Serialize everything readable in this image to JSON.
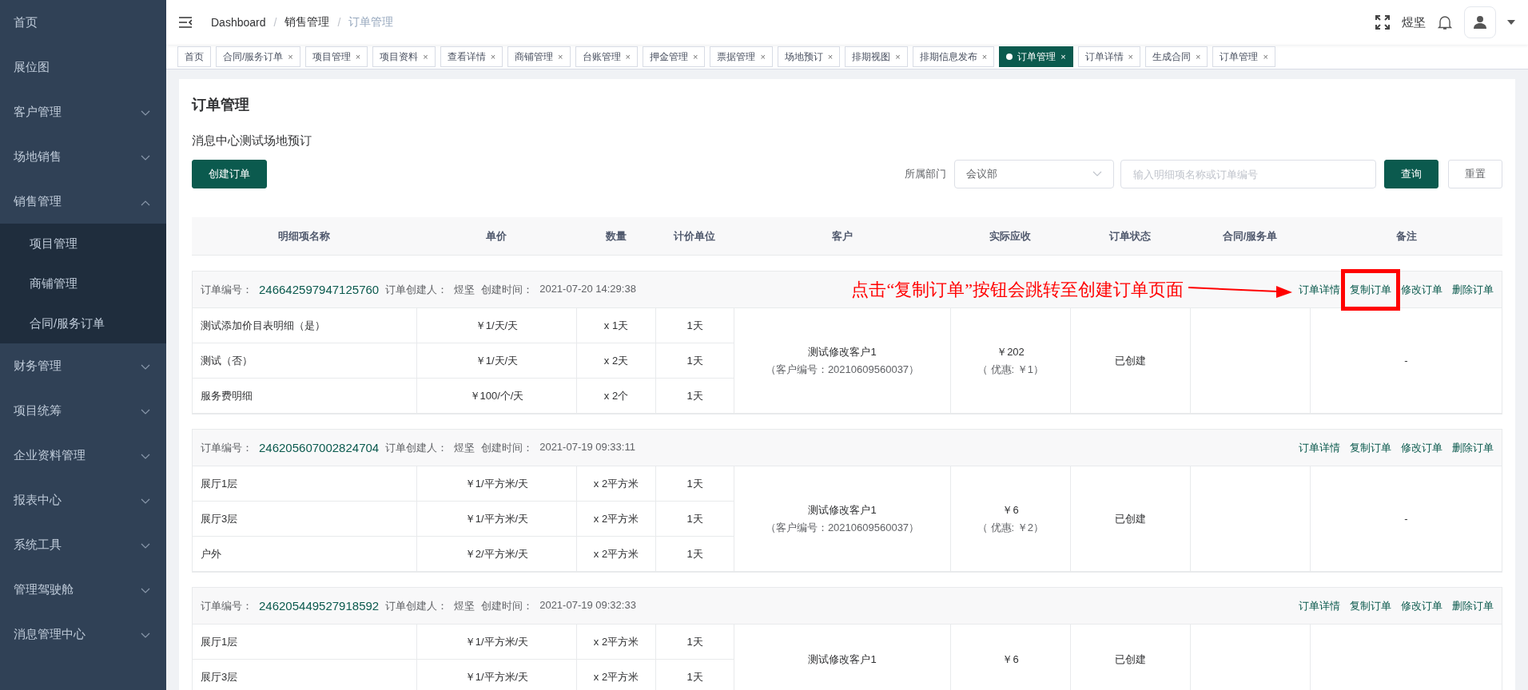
{
  "sidebar": {
    "items": [
      {
        "label": "首页",
        "kind": "link"
      },
      {
        "label": "展位图",
        "kind": "link"
      },
      {
        "label": "客户管理",
        "kind": "submenu",
        "expanded": false
      },
      {
        "label": "场地销售",
        "kind": "submenu",
        "expanded": false
      },
      {
        "label": "销售管理",
        "kind": "submenu",
        "expanded": true,
        "children": [
          {
            "label": "项目管理"
          },
          {
            "label": "商铺管理"
          },
          {
            "label": "合同/服务订单"
          }
        ]
      },
      {
        "label": "财务管理",
        "kind": "submenu",
        "expanded": false
      },
      {
        "label": "项目统筹",
        "kind": "submenu",
        "expanded": false
      },
      {
        "label": "企业资料管理",
        "kind": "submenu",
        "expanded": false
      },
      {
        "label": "报表中心",
        "kind": "submenu",
        "expanded": false
      },
      {
        "label": "系统工具",
        "kind": "submenu",
        "expanded": false
      },
      {
        "label": "管理驾驶舱",
        "kind": "submenu",
        "expanded": false
      },
      {
        "label": "消息管理中心",
        "kind": "submenu",
        "expanded": false
      }
    ]
  },
  "breadcrumb": [
    {
      "label": "Dashboard"
    },
    {
      "separator": "/",
      "label": "销售管理"
    },
    {
      "separator": "/",
      "label": "订单管理"
    }
  ],
  "user": {
    "name": "煜坚"
  },
  "tabs": [
    {
      "label": "首页",
      "selected": false,
      "closable": false
    },
    {
      "label": "合同/服务订单",
      "selected": false,
      "closable": true,
      "close": "×"
    },
    {
      "label": "项目管理",
      "selected": false,
      "closable": true,
      "close": "×"
    },
    {
      "label": "项目资料",
      "selected": false,
      "closable": true,
      "close": "×"
    },
    {
      "label": "查看详情",
      "selected": false,
      "closable": true,
      "close": "×"
    },
    {
      "label": "商铺管理",
      "selected": false,
      "closable": true,
      "close": "×"
    },
    {
      "label": "台账管理",
      "selected": false,
      "closable": true,
      "close": "×"
    },
    {
      "label": "押金管理",
      "selected": false,
      "closable": true,
      "close": "×"
    },
    {
      "label": "票据管理",
      "selected": false,
      "closable": true,
      "close": "×"
    },
    {
      "label": "场地预订",
      "selected": false,
      "closable": true,
      "close": "×"
    },
    {
      "label": "排期视图",
      "selected": false,
      "closable": true,
      "close": "×"
    },
    {
      "label": "排期信息发布",
      "selected": false,
      "closable": true,
      "close": "×"
    },
    {
      "label": "订单管理",
      "selected": true,
      "closable": true,
      "close": "×"
    },
    {
      "label": "订单详情",
      "selected": false,
      "closable": true,
      "close": "×"
    },
    {
      "label": "生成合同",
      "selected": false,
      "closable": true,
      "close": "×"
    },
    {
      "label": "订单管理",
      "selected": false,
      "closable": true,
      "close": "×"
    }
  ],
  "page": {
    "title": "订单管理",
    "subtitle": "消息中心测试场地预订",
    "create_button": "创建订单",
    "filter": {
      "label": "所属部门",
      "department": "会议部",
      "placeholder": "输入明细项名称或订单编号",
      "query_button": "查询",
      "reset_button": "重置"
    }
  },
  "table": {
    "columns": [
      "明细项名称",
      "单价",
      "数量",
      "计价单位",
      "客户",
      "实际应收",
      "订单状态",
      "合同/服务单",
      "备注"
    ]
  },
  "orders": [
    {
      "meta": [
        {
          "label": "订单编号：",
          "value": "246642597947125760",
          "kind": "link"
        },
        {
          "label": "订单创建人：",
          "value": "煜坚",
          "kind": "text"
        },
        {
          "label": "创建时间：",
          "value": "2021-07-20 14:29:38",
          "kind": "text"
        }
      ],
      "annotation": {
        "text": "点击“复制订单”按钮会跳转至创建订单页面"
      },
      "actions": [
        {
          "label": "订单详情",
          "highlighted": false
        },
        {
          "label": "复制订单",
          "highlighted": true
        },
        {
          "label": "修改订单",
          "highlighted": false
        },
        {
          "label": "删除订单",
          "highlighted": false
        }
      ],
      "items": [
        {
          "name": "测试添加价目表明细（是）",
          "price": "￥1/天/天",
          "qty": "x 1天",
          "unit": "1天"
        },
        {
          "name": "测试（否）",
          "price": "￥1/天/天",
          "qty": "x 2天",
          "unit": "1天"
        },
        {
          "name": "服务费明细",
          "price": "￥100/个/天",
          "qty": "x 2个",
          "unit": "1天"
        }
      ],
      "customer": {
        "name": "测试修改客户1",
        "code": "（客户编号：20210609560037）"
      },
      "amount": "￥202",
      "discount": "（ 优惠: ￥1）",
      "status": "已创建",
      "remark": "-"
    },
    {
      "meta": [
        {
          "label": "订单编号：",
          "value": "246205607002824704",
          "kind": "link"
        },
        {
          "label": "订单创建人：",
          "value": "煜坚",
          "kind": "text"
        },
        {
          "label": "创建时间：",
          "value": "2021-07-19 09:33:11",
          "kind": "text"
        }
      ],
      "actions": [
        {
          "label": "订单详情",
          "highlighted": false
        },
        {
          "label": "复制订单",
          "highlighted": false
        },
        {
          "label": "修改订单",
          "highlighted": false
        },
        {
          "label": "删除订单",
          "highlighted": false
        }
      ],
      "items": [
        {
          "name": "展厅1层",
          "price": "￥1/平方米/天",
          "qty": "x 2平方米",
          "unit": "1天"
        },
        {
          "name": "展厅3层",
          "price": "￥1/平方米/天",
          "qty": "x 2平方米",
          "unit": "1天"
        },
        {
          "name": "户外",
          "price": "￥2/平方米/天",
          "qty": "x 2平方米",
          "unit": "1天"
        }
      ],
      "customer": {
        "name": "测试修改客户1",
        "code": "（客户编号：20210609560037）"
      },
      "amount": "￥6",
      "discount": "（ 优惠: ￥2）",
      "status": "已创建",
      "remark": "-"
    },
    {
      "meta": [
        {
          "label": "订单编号：",
          "value": "246205449527918592",
          "kind": "link"
        },
        {
          "label": "订单创建人：",
          "value": "煜坚",
          "kind": "text"
        },
        {
          "label": "创建时间：",
          "value": "2021-07-19 09:32:33",
          "kind": "text"
        }
      ],
      "actions": [
        {
          "label": "订单详情",
          "highlighted": false
        },
        {
          "label": "复制订单",
          "highlighted": false
        },
        {
          "label": "修改订单",
          "highlighted": false
        },
        {
          "label": "删除订单",
          "highlighted": false
        }
      ],
      "items": [
        {
          "name": "展厅1层",
          "price": "￥1/平方米/天",
          "qty": "x 2平方米",
          "unit": "1天"
        },
        {
          "name": "展厅3层",
          "price": "￥1/平方米/天",
          "qty": "x 2平方米",
          "unit": "1天"
        }
      ],
      "customer": {
        "name": "测试修改客户1"
      },
      "amount": "￥6",
      "status": "已创建"
    }
  ]
}
